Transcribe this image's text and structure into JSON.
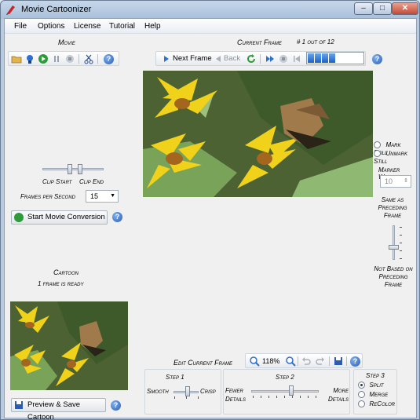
{
  "window": {
    "title": "Movie Cartoonizer",
    "controls": {
      "minimize": "–",
      "maximize": "□",
      "close": "✕"
    }
  },
  "menu": [
    "File",
    "Options",
    "License",
    "Tutorial",
    "Help"
  ],
  "movie": {
    "title": "Movie",
    "clip_start_label": "Clip Start",
    "clip_end_label": "Clip End",
    "fps_label": "Frames per Second",
    "fps_value": "15",
    "start_button": "Start Movie Conversion"
  },
  "current_frame": {
    "title": "Current Frame",
    "counter": "# 1 out of 12",
    "next_label": "Next Frame",
    "back_label": "Back",
    "progress_segments": 4
  },
  "still": {
    "mark_still": "Mark Still",
    "unmark_still": "Unmark Still",
    "marker_width_label": "Marker Width",
    "marker_width_value": "10",
    "same_as_label": "Same as Preceding Frame",
    "not_based_label": "Not Based on Preceding Frame"
  },
  "cartoon": {
    "title": "Cartoon",
    "status": "1 frame is ready",
    "preview_button": "Preview & Save Cartoon"
  },
  "edit": {
    "title": "Edit Current Frame",
    "zoom": "118%",
    "step1": {
      "title": "Step 1",
      "left": "Smooth",
      "right": "Crisp"
    },
    "step2": {
      "title": "Step 2",
      "left": "Fewer Details",
      "right": "More Details"
    },
    "step3": {
      "title": "Step 3",
      "options": [
        "Split",
        "Merge",
        "ReColor"
      ],
      "selected": "Split"
    }
  },
  "colors": {
    "accent": "#2a5cb3",
    "play_green": "#2e9b3a",
    "flower_yellow": "#f1d21a",
    "leaf_dark": "#3e5a2a",
    "leaf_mid": "#7aa35a",
    "butterfly": "#a17a4c"
  },
  "icons": {
    "movie_toolbar": [
      "open-folder-icon",
      "filmstrip-icon",
      "play-icon",
      "pause-icon",
      "stop-icon",
      "cut-icon",
      "help-icon"
    ],
    "frame_toolbar": [
      "next-arrow-icon",
      "back-arrow-icon",
      "refresh-icon",
      "fast-forward-icon",
      "stop-icon",
      "skip-back-icon",
      "help-icon"
    ],
    "edit_toolbar": [
      "zoom-in-icon",
      "zoom-out-icon",
      "undo-icon",
      "redo-icon",
      "save-icon",
      "help-icon"
    ]
  }
}
